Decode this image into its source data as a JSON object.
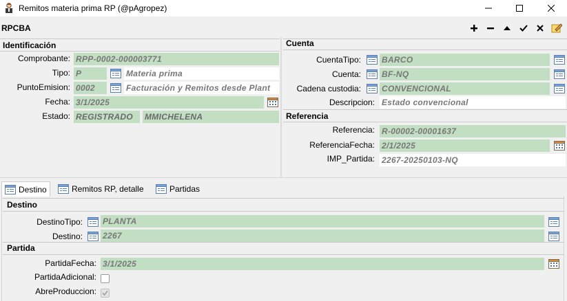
{
  "window": {
    "title": "Remitos materia prima RP (@pAgropez)"
  },
  "toolbar": {
    "code": "RPCBA"
  },
  "ident": {
    "heading": "Identificación",
    "comprobante": {
      "label": "Comprobante:",
      "value": "RPP-0002-000003771"
    },
    "tipo": {
      "label": "Tipo:",
      "code": "P",
      "desc": "Materia prima"
    },
    "punto": {
      "label": "PuntoEmision:",
      "code": "0002",
      "desc": "Facturación y Remitos desde Plant"
    },
    "fecha": {
      "label": "Fecha:",
      "value": "3/1/2025"
    },
    "estado": {
      "label": "Estado:",
      "value": "REGISTRADO",
      "user": "MMICHELENA"
    }
  },
  "cuenta": {
    "heading": "Cuenta",
    "tipo": {
      "label": "CuentaTipo:",
      "value": "BARCO"
    },
    "cuenta": {
      "label": "Cuenta:",
      "value": "BF-NQ"
    },
    "cadena": {
      "label": "Cadena custodia:",
      "value": "CONVENCIONAL"
    },
    "descripcion": {
      "label": "Descripcion:",
      "value": "Estado convencional"
    }
  },
  "referencia": {
    "heading": "Referencia",
    "ref": {
      "label": "Referencia:",
      "value": "R-00002-00001637"
    },
    "fecha": {
      "label": "ReferenciaFecha:",
      "value": "2/1/2025"
    },
    "imp": {
      "label": "IMP_Partida:",
      "value": "2267-20250103-NQ"
    }
  },
  "tabs": [
    {
      "label": "Destino"
    },
    {
      "label": "Remitos RP, detalle"
    },
    {
      "label": "Partidas"
    }
  ],
  "destino": {
    "heading": "Destino",
    "tipo": {
      "label": "DestinoTipo:",
      "value": "PLANTA"
    },
    "destino": {
      "label": "Destino:",
      "value": "2267"
    }
  },
  "partida": {
    "heading": "Partida",
    "fecha": {
      "label": "PartidaFecha:",
      "value": "3/1/2025"
    },
    "adicional": {
      "label": "PartidaAdicional:",
      "checked": false
    },
    "abre": {
      "label": "AbreProduccion:",
      "checked": true
    }
  },
  "colors": {
    "field": "#c3dfc3",
    "background": "#f0f0f0"
  }
}
